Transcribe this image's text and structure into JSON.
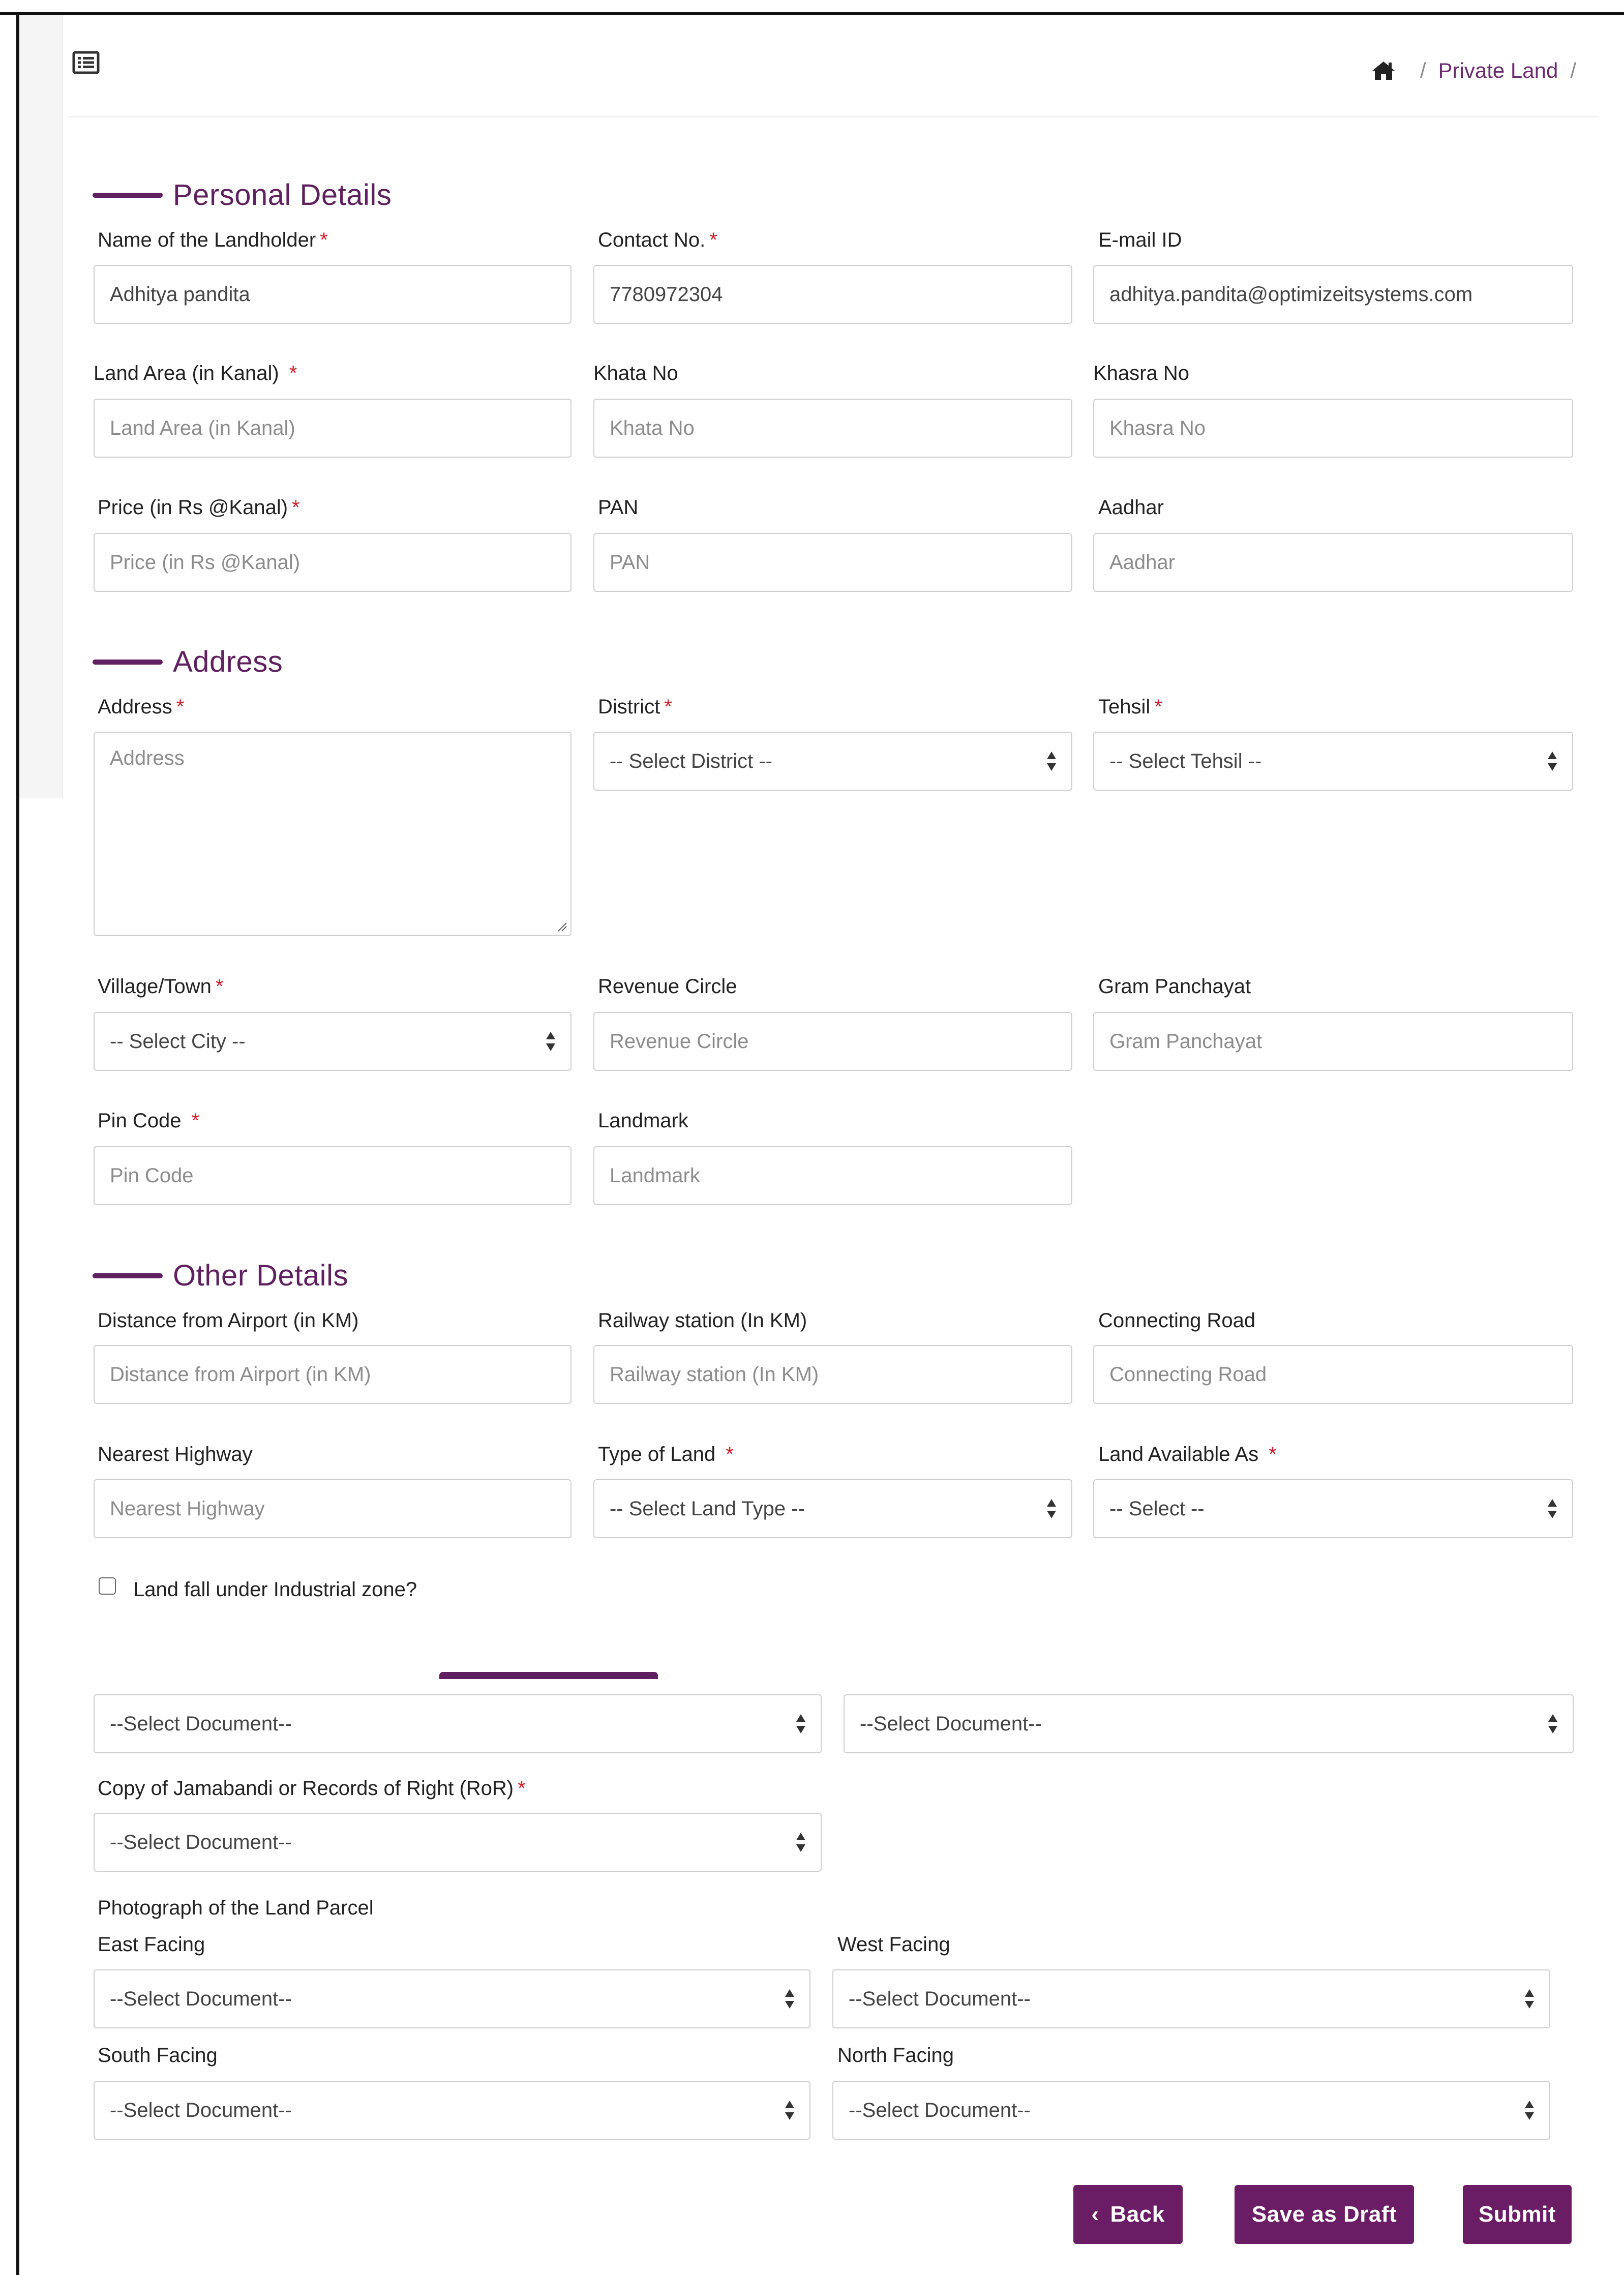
{
  "breadcrumb": {
    "sep1": "/",
    "current": "Private Land",
    "sep2": "/"
  },
  "sections": {
    "personal": "Personal Details",
    "address": "Address",
    "other": "Other Details"
  },
  "personal": {
    "name_label": "Name of the Landholder",
    "name_value": "Adhitya pandita",
    "contact_label": "Contact No.",
    "contact_value": "7780972304",
    "email_label": "E-mail ID",
    "email_value": "adhitya.pandita@optimizeitsystems.com",
    "land_area_label": "Land Area (in Kanal)",
    "land_area_placeholder": "Land Area (in Kanal)",
    "khata_label": "Khata No",
    "khata_placeholder": "Khata No",
    "khasra_label": "Khasra No",
    "khasra_placeholder": "Khasra No",
    "price_label": "Price (in Rs @Kanal)",
    "price_placeholder": "Price (in Rs @Kanal)",
    "pan_label": "PAN",
    "pan_placeholder": "PAN",
    "aadhar_label": "Aadhar",
    "aadhar_placeholder": "Aadhar"
  },
  "address": {
    "address_label": "Address",
    "address_placeholder": "Address",
    "district_label": "District",
    "district_value": "-- Select District --",
    "tehsil_label": "Tehsil",
    "tehsil_value": "-- Select Tehsil --",
    "village_label": "Village/Town",
    "village_value": "-- Select City --",
    "revenue_label": "Revenue Circle",
    "revenue_placeholder": "Revenue Circle",
    "gram_label": "Gram Panchayat",
    "gram_placeholder": "Gram Panchayat",
    "pin_label": "Pin Code",
    "pin_placeholder": "Pin Code",
    "landmark_label": "Landmark",
    "landmark_placeholder": "Landmark"
  },
  "other": {
    "airport_label": "Distance from Airport (in KM)",
    "airport_placeholder": "Distance from Airport (in KM)",
    "railway_label": "Railway station (In KM)",
    "railway_placeholder": "Railway station (In KM)",
    "road_label": "Connecting Road",
    "road_placeholder": "Connecting Road",
    "highway_label": "Nearest Highway",
    "highway_placeholder": "Nearest Highway",
    "land_type_label": "Type of Land",
    "land_type_value": "-- Select Land Type --",
    "available_label": "Land Available As",
    "available_value": "-- Select --",
    "industrial_label": "Land fall under Industrial zone?"
  },
  "documents": {
    "doc_select_1": "--Select Document--",
    "doc_select_2": "--Select Document--",
    "ror_label": "Copy of Jamabandi or Records of Right (RoR)",
    "ror_value": "--Select Document--",
    "photo_label": "Photograph of the Land Parcel",
    "east_label": "East Facing",
    "east_value": "--Select Document--",
    "west_label": "West Facing",
    "west_value": "--Select Document--",
    "south_label": "South Facing",
    "south_value": "--Select Document--",
    "north_label": "North Facing",
    "north_value": "--Select Document--"
  },
  "required_mark": "*",
  "actions": {
    "back_chevron": "‹",
    "back": "Back",
    "draft": "Save as Draft",
    "submit": "Submit"
  },
  "colors": {
    "accent": "#5f2060",
    "button": "#6a1d65",
    "required": "#d21f2c"
  }
}
